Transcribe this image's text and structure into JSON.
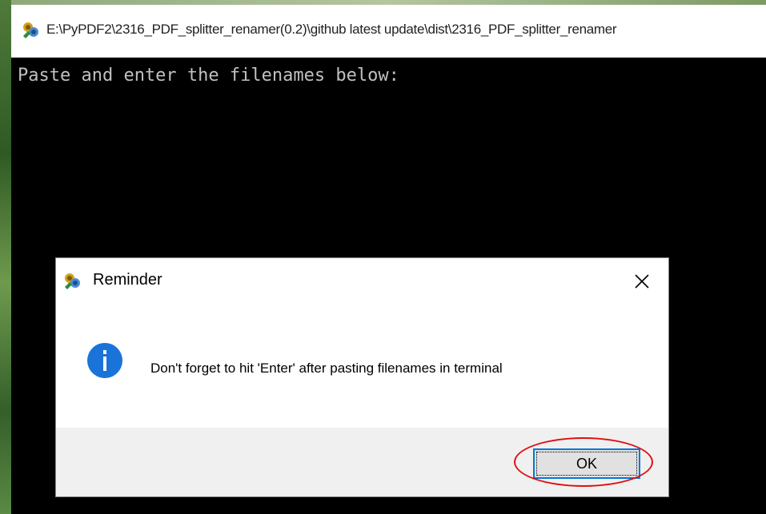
{
  "console": {
    "title": "E:\\PyPDF2\\2316_PDF_splitter_renamer(0.2)\\github latest update\\dist\\2316_PDF_splitter_renamer",
    "output_line": "Paste and enter the filenames below:"
  },
  "dialog": {
    "title": "Reminder",
    "message": "Don't forget to hit 'Enter' after pasting filenames in terminal",
    "ok_label": "OK",
    "icon": "info-icon"
  },
  "colors": {
    "info_blue": "#1a73d9",
    "highlight": "#e01010",
    "button_focus": "#0078d7"
  }
}
